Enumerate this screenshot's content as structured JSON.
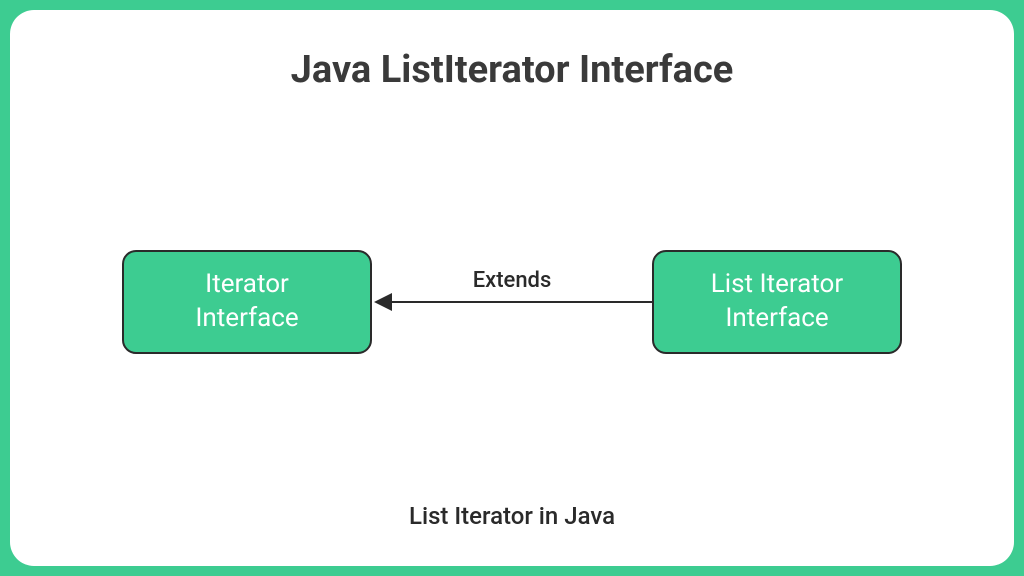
{
  "title": "Java ListIterator Interface",
  "diagram": {
    "left_box": {
      "line1": "Iterator",
      "line2": "Interface"
    },
    "right_box": {
      "line1": "List Iterator",
      "line2": "Interface"
    },
    "arrow_label": "Extends"
  },
  "caption": "List Iterator in Java",
  "colors": {
    "accent": "#3dcc91",
    "text_dark": "#3a3a3a"
  }
}
